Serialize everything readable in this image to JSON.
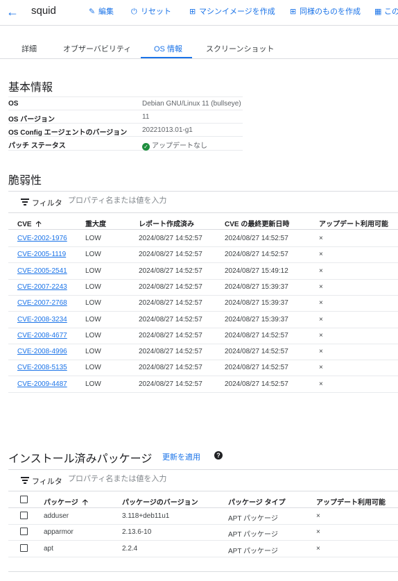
{
  "header": {
    "title": "squid",
    "actions": {
      "edit": "編集",
      "reset": "リセット",
      "create_image": "マシンイメージを作成",
      "create_similar": "同様のものを作成",
      "more": "この"
    }
  },
  "tabs": [
    "詳細",
    "オブザーバビリティ",
    "OS 情報",
    "スクリーンショット"
  ],
  "active_tab": "OS 情報",
  "basic_info": {
    "title": "基本情報",
    "rows": [
      {
        "key": "OS",
        "value": "Debian GNU/Linux 11 (bullseye)"
      },
      {
        "key": "OS バージョン",
        "value": "11"
      },
      {
        "key": "OS Config エージェントのバージョン",
        "value": "20221013.01-g1"
      },
      {
        "key": "パッチ ステータス",
        "value": "アップデートなし"
      }
    ]
  },
  "vulnerabilities": {
    "title": "脆弱性",
    "filter_label": "フィルタ",
    "filter_placeholder": "プロパティ名または値を入力",
    "columns": {
      "cve": "CVE",
      "severity": "重大度",
      "reported": "レポート作成済み",
      "last_updated": "CVE の最終更新日時",
      "update_available": "アップデート利用可能"
    },
    "rows": [
      {
        "cve": "CVE-2002-1976",
        "severity": "LOW",
        "reported": "2024/08/27 14:52:57",
        "last_updated": "2024/08/27 14:52:57",
        "update": "×"
      },
      {
        "cve": "CVE-2005-1119",
        "severity": "LOW",
        "reported": "2024/08/27 14:52:57",
        "last_updated": "2024/08/27 14:52:57",
        "update": "×"
      },
      {
        "cve": "CVE-2005-2541",
        "severity": "LOW",
        "reported": "2024/08/27 14:52:57",
        "last_updated": "2024/08/27 15:49:12",
        "update": "×"
      },
      {
        "cve": "CVE-2007-2243",
        "severity": "LOW",
        "reported": "2024/08/27 14:52:57",
        "last_updated": "2024/08/27 15:39:37",
        "update": "×"
      },
      {
        "cve": "CVE-2007-2768",
        "severity": "LOW",
        "reported": "2024/08/27 14:52:57",
        "last_updated": "2024/08/27 15:39:37",
        "update": "×"
      },
      {
        "cve": "CVE-2008-3234",
        "severity": "LOW",
        "reported": "2024/08/27 14:52:57",
        "last_updated": "2024/08/27 15:39:37",
        "update": "×"
      },
      {
        "cve": "CVE-2008-4677",
        "severity": "LOW",
        "reported": "2024/08/27 14:52:57",
        "last_updated": "2024/08/27 14:52:57",
        "update": "×"
      },
      {
        "cve": "CVE-2008-4996",
        "severity": "LOW",
        "reported": "2024/08/27 14:52:57",
        "last_updated": "2024/08/27 14:52:57",
        "update": "×"
      },
      {
        "cve": "CVE-2008-5135",
        "severity": "LOW",
        "reported": "2024/08/27 14:52:57",
        "last_updated": "2024/08/27 14:52:57",
        "update": "×"
      },
      {
        "cve": "CVE-2009-4487",
        "severity": "LOW",
        "reported": "2024/08/27 14:52:57",
        "last_updated": "2024/08/27 14:52:57",
        "update": "×"
      }
    ]
  },
  "packages": {
    "title": "インストール済みパッケージ",
    "apply_link": "更新を適用",
    "help_icon": "?",
    "filter_label": "フィルタ",
    "filter_placeholder": "プロパティ名または値を入力",
    "columns": {
      "package": "パッケージ",
      "version": "パッケージのバージョン",
      "type": "パッケージ タイプ",
      "update_available": "アップデート利用可能"
    },
    "rows": [
      {
        "name": "adduser",
        "version": "3.118+deb11u1",
        "type": "APT パッケージ",
        "update": "×"
      },
      {
        "name": "apparmor",
        "version": "2.13.6-10",
        "type": "APT パッケージ",
        "update": "×"
      },
      {
        "name": "apt",
        "version": "2.2.4",
        "type": "APT パッケージ",
        "update": "×"
      }
    ]
  },
  "colors": {
    "accent": "#1a73e8",
    "success": "#1e8e3e",
    "divider": "#dadce0"
  }
}
